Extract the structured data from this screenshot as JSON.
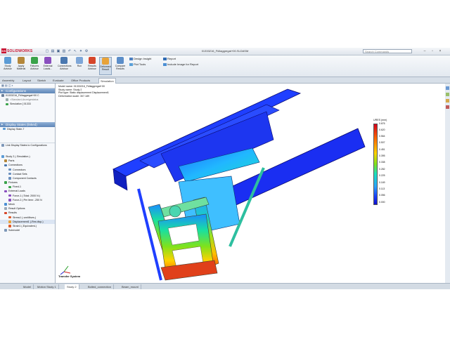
{
  "app": {
    "logo": "SOLIDWORKS",
    "doc_title": "01333216_Füllaggregat+00.SLDASM",
    "search_placeholder": "Search Commands"
  },
  "ribbon": {
    "buttons": [
      "Study Advisor",
      "Apply Material",
      "Fixtures Advisor",
      "External Loads...",
      "Connections Advisor",
      "Run",
      "Results Advisor",
      "Deformed Result",
      "Compare Results"
    ],
    "small_tools": [
      "Design Insight",
      "Plot Tools",
      "Report",
      "Include Image for Report"
    ]
  },
  "tabs": [
    "Assembly",
    "Layout",
    "Sketch",
    "Evaluate",
    "Office Products",
    "Simulation"
  ],
  "panel": {
    "config_header": "Configurations",
    "display_header": "Display States (linked)",
    "link_states": "Link Display States to Configurations",
    "tree": [
      "01333216_Füllaggregat+00 C",
      "<Standard-Anzeigestatus",
      "Simulation [ 01333",
      "Display State-7",
      "Study 2 (-Simulation-)",
      "Parts",
      "Connections",
      "Connectors",
      "Contact Sets",
      "Component Contacts",
      "Fixtures",
      "Fixed-1",
      "External Loads",
      "Force-1 (:Total: 2000 N:)",
      "Force-2 (:Per item: -250 N",
      "Mesh",
      "Result Options",
      "Results",
      "Stress1 (-vonMises-)",
      "Displacement1 (-Res disp-)",
      "Strain1 (-Equivalent-)",
      "Submodel"
    ]
  },
  "viewport": {
    "model_info": [
      "Model name: 01333216_Füllaggregat+00",
      "Study name: Study 2",
      "Plot type: Static displacement Displacement1",
      "Deformation scale: 307.189"
    ],
    "legend_title": "URES (mm)",
    "legend_values": [
      "0.676",
      "0.620",
      "0.564",
      "0.507",
      "0.451",
      "0.395",
      "0.338",
      "0.282",
      "0.225",
      "0.169",
      "0.113",
      "0.056",
      "0.000"
    ],
    "transfer_label": "Transfer System"
  },
  "status_tabs": [
    "Model",
    "Motion Study 1",
    "Study 2",
    "Bolted_connection",
    "Beam_mount"
  ],
  "colors": {
    "accent": "#c8102e",
    "ribbon_active": "#cfdceb",
    "legend_max": "#d4001c",
    "legend_min": "#1010d0"
  }
}
